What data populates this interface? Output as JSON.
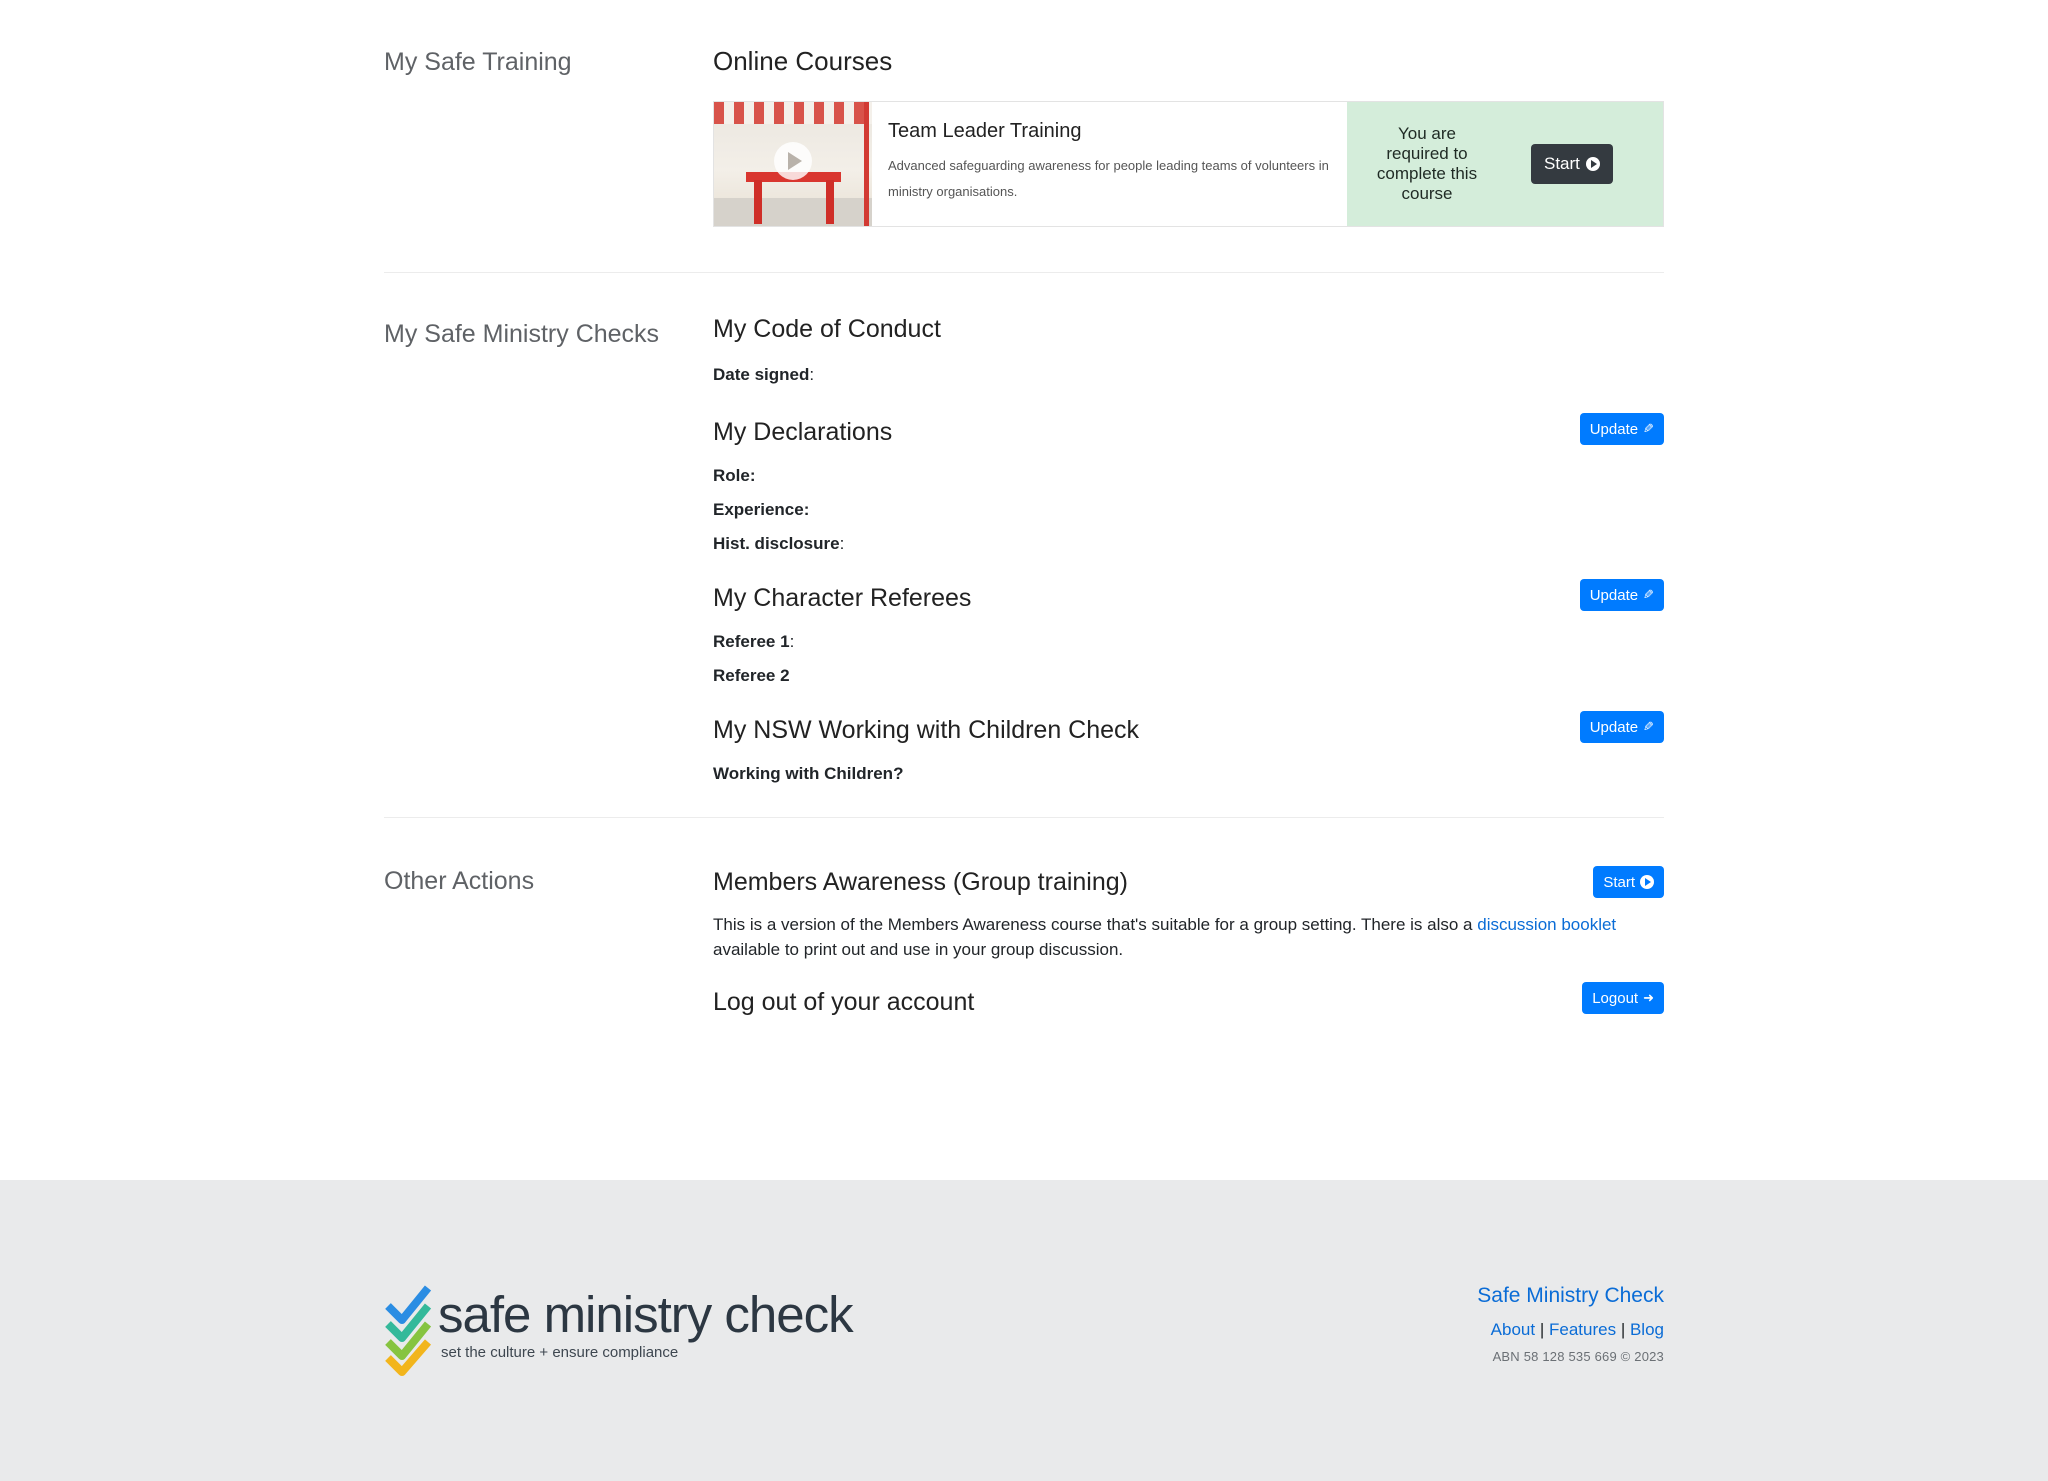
{
  "training": {
    "section_label": "My Safe Training",
    "heading": "Online Courses",
    "course": {
      "title": "Team Leader Training",
      "description": "Advanced safeguarding awareness for people leading teams of volunteers in ministry organisations.",
      "status": "You are required to complete this course",
      "start_label": "Start"
    }
  },
  "checks": {
    "section_label": "My Safe Ministry Checks",
    "code_of_conduct": {
      "heading": "My Code of Conduct",
      "date_signed_label": "Date signed",
      "date_signed_colon": ":"
    },
    "declarations": {
      "heading": "My Declarations",
      "update_label": "Update",
      "role_label": "Role:",
      "experience_label": "Experience:",
      "hist_label": "Hist. disclosure",
      "hist_colon": ":"
    },
    "referees": {
      "heading": "My Character Referees",
      "update_label": "Update",
      "referee1_label": "Referee 1",
      "referee1_colon": ":",
      "referee2_label": "Referee 2"
    },
    "wwcc": {
      "heading": "My NSW Working with Children Check",
      "update_label": "Update",
      "question_label": "Working with Children?"
    }
  },
  "other": {
    "section_label": "Other Actions",
    "members": {
      "heading": "Members Awareness (Group training)",
      "start_label": "Start",
      "text_before": "This is a version of the Members Awareness course that's suitable for a group setting. There is also a ",
      "link_text": "discussion booklet",
      "text_after": " available to print out and use in your group discussion."
    },
    "logout": {
      "heading": "Log out of your account",
      "button_label": "Logout"
    }
  },
  "footer": {
    "logo_word": "safe ministry check",
    "logo_tagline": "set the culture + ensure compliance",
    "title": "Safe Ministry Check",
    "links": [
      "About",
      "Features",
      "Blog"
    ],
    "separator": "|",
    "abn": "ABN 58 128 535 669 © 2023"
  },
  "colors": {
    "primary": "#007bff",
    "dark_button": "#343a40",
    "status_bg": "#d4edda",
    "footer_bg": "#e9eaeb",
    "link": "#0a6cd6"
  },
  "icons": [
    "play-icon",
    "play-circle-icon",
    "pencil-icon",
    "logout-icon",
    "checkmark-logo-icon"
  ]
}
